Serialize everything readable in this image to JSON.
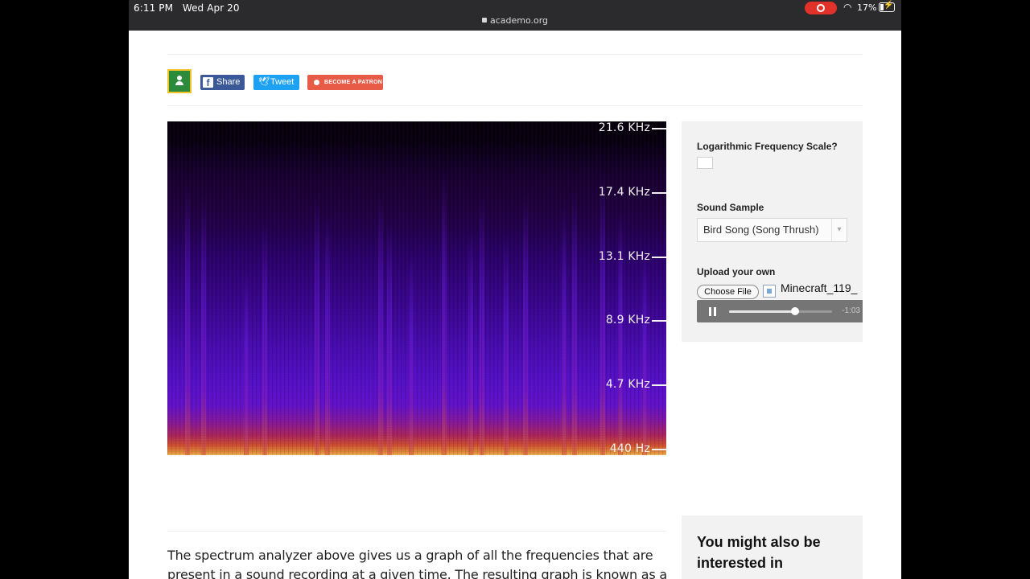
{
  "status_bar": {
    "time": "6:11 PM",
    "date": "Wed Apr 20",
    "url": "academo.org",
    "battery": "17%"
  },
  "social": {
    "share_label": "Share",
    "tweet_label": "Tweet",
    "patron_label": "BECOME A PATRON",
    "colors": {
      "facebook": "#3b5998",
      "twitter": "#1da1f2",
      "patreon": "#e85b46",
      "classroom": "#2c8b3a"
    }
  },
  "spectrogram": {
    "frequency_labels": [
      "21.6 KHz",
      "17.4 KHz",
      "13.1 KHz",
      "8.9 KHz",
      "4.7 KHz",
      "440 Hz"
    ]
  },
  "controls": {
    "log_scale_label": "Logarithmic Frequency Scale?",
    "log_scale_checked": false,
    "sound_sample_label": "Sound Sample",
    "sound_sample_value": "Bird Song (Song Thrush)",
    "upload_label": "Upload your own",
    "choose_file_label": "Choose File",
    "file_name": "Minecraft_119_",
    "player": {
      "remaining": "-1:03",
      "progress": 0.64
    }
  },
  "sidebar": {
    "also_title": "You might also be interested in"
  },
  "article": {
    "text": "The spectrum analyzer above gives us a graph of all the frequencies that are present in a sound recording at a given time. The resulting graph is known as a spectrogram."
  }
}
